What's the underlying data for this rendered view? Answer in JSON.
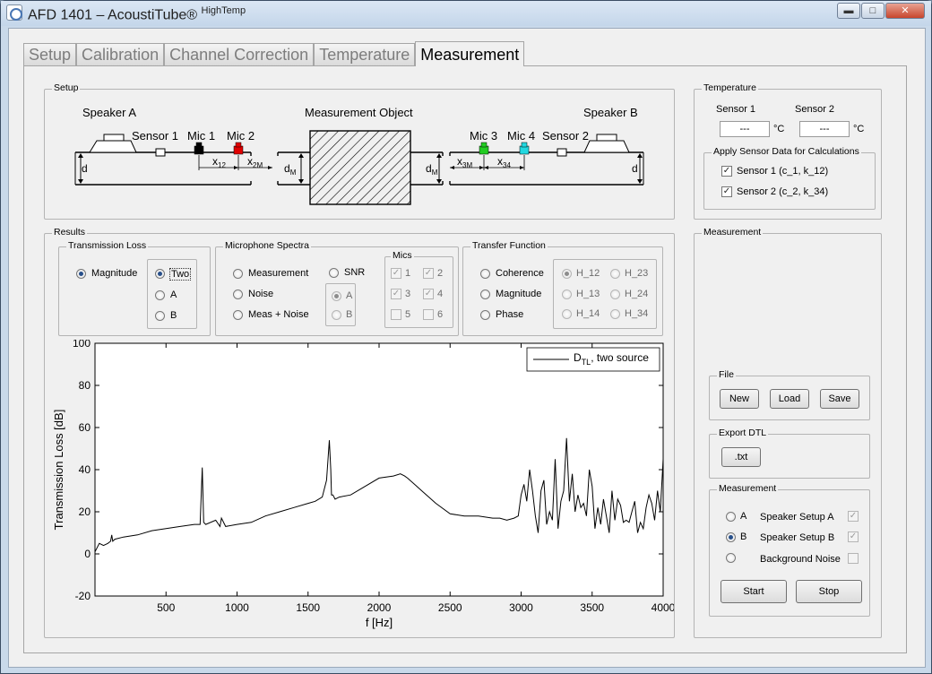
{
  "window": {
    "title": "AFD 1401 – AcoustiTube",
    "title_reg": "®",
    "title_sup": "HighTemp",
    "buttons": {
      "minimize": "▬",
      "maximize": "□",
      "close": "✕"
    }
  },
  "tabs": [
    "Setup",
    "Calibration",
    "Channel Correction",
    "Temperature",
    "Measurement"
  ],
  "active_tab": "Measurement",
  "setup": {
    "label": "Setup",
    "speaker_a": "Speaker A",
    "speaker_b": "Speaker B",
    "sensor1": "Sensor 1",
    "sensor2": "Sensor 2",
    "mic1": "Mic 1",
    "mic2": "Mic 2",
    "mic3": "Mic 3",
    "mic4": "Mic 4",
    "object": "Measurement Object",
    "d": "d",
    "d_right": "d",
    "dm_left": "d",
    "dm_right": "d",
    "dm_sub": "M",
    "x12": "x",
    "x12_sub": "12",
    "x2m": "x",
    "x2m_sub": "2M",
    "x3m": "x",
    "x3m_sub": "3M",
    "x34": "x",
    "x34_sub": "34",
    "colors": {
      "mic1": "#000000",
      "mic2": "#e00000",
      "mic3": "#22cc22",
      "mic4": "#22d8e0"
    }
  },
  "temperature": {
    "label": "Temperature",
    "sensor1_label": "Sensor 1",
    "sensor2_label": "Sensor 2",
    "sensor1_value": "---",
    "sensor2_value": "---",
    "unit": "°C",
    "apply_label": "Apply Sensor Data for Calculations",
    "apply_items": [
      {
        "label": "Sensor 1 (c_1, k_12)",
        "checked": true
      },
      {
        "label": "Sensor 2 (c_2, k_34)",
        "checked": true
      }
    ]
  },
  "results": {
    "label": "Results",
    "transmission_loss": {
      "label": "Transmission Loss",
      "magnitude": "Magnitude",
      "options": [
        "Two",
        "A",
        "B"
      ],
      "selected": "Two"
    },
    "mic_spectra": {
      "label": "Microphone Spectra",
      "options": [
        "Measurement",
        "Noise",
        "Meas + Noise"
      ],
      "snr": "SNR",
      "snr_options": [
        "A",
        "B"
      ],
      "mics_label": "Mics",
      "mics": [
        "1",
        "2",
        "3",
        "4",
        "5",
        "6"
      ],
      "mics_checked": [
        true,
        true,
        true,
        true,
        false,
        false
      ]
    },
    "transfer_function": {
      "label": "Transfer Function",
      "options": [
        "Coherence",
        "Magnitude",
        "Phase"
      ],
      "h_options": [
        "H_12",
        "H_23",
        "H_13",
        "H_24",
        "H_14",
        "H_34"
      ]
    }
  },
  "chart_data": {
    "type": "line",
    "xlabel": "f [Hz]",
    "ylabel": "Transmission Loss [dB]",
    "xlim": [
      0,
      4000
    ],
    "ylim": [
      -20,
      100
    ],
    "xticks": [
      "500",
      "1000",
      "1500",
      "2000",
      "2500",
      "3000",
      "3500",
      "4000"
    ],
    "yticks": [
      "-20",
      "0",
      "20",
      "40",
      "60",
      "80",
      "100"
    ],
    "legend": {
      "prefix": "D",
      "sub": "TL",
      "suffix": ", two source"
    },
    "legend_position": "top-right",
    "grid": false,
    "series": [
      {
        "name": "D_TL, two source",
        "x": [
          0,
          30,
          60,
          90,
          110,
          118,
          125,
          140,
          200,
          300,
          400,
          500,
          600,
          700,
          740,
          755,
          765,
          780,
          850,
          880,
          890,
          920,
          1000,
          1100,
          1200,
          1300,
          1400,
          1500,
          1550,
          1600,
          1630,
          1650,
          1660,
          1665,
          1675,
          1690,
          1720,
          1800,
          1900,
          2000,
          2100,
          2150,
          2180,
          2200,
          2250,
          2300,
          2400,
          2500,
          2600,
          2700,
          2800,
          2850,
          2900,
          2950,
          2980,
          3000,
          3020,
          3040,
          3060,
          3080,
          3100,
          3120,
          3140,
          3160,
          3180,
          3200,
          3220,
          3240,
          3260,
          3280,
          3300,
          3320,
          3340,
          3360,
          3380,
          3400,
          3420,
          3440,
          3460,
          3480,
          3500,
          3520,
          3540,
          3560,
          3580,
          3600,
          3620,
          3640,
          3660,
          3680,
          3700,
          3720,
          3740,
          3760,
          3780,
          3800,
          3820,
          3840,
          3860,
          3880,
          3900,
          3920,
          3940,
          3960,
          3980,
          4000
        ],
        "y": [
          1,
          5,
          4,
          5,
          6,
          9,
          6,
          7,
          8,
          9,
          11,
          12,
          13,
          14,
          14,
          41,
          15,
          14,
          16,
          13,
          17,
          13,
          14,
          15,
          18,
          20,
          22,
          24,
          25,
          27,
          35,
          54,
          40,
          28,
          28,
          26,
          27,
          28,
          32,
          36,
          37,
          38,
          37,
          36,
          33,
          30,
          24,
          19,
          18,
          18,
          17,
          17,
          16,
          17,
          18,
          28,
          33,
          25,
          40,
          30,
          18,
          10,
          30,
          35,
          14,
          20,
          16,
          45,
          12,
          25,
          30,
          55,
          25,
          38,
          20,
          28,
          22,
          24,
          18,
          40,
          32,
          12,
          22,
          14,
          26,
          18,
          10,
          30,
          16,
          26,
          23,
          15,
          16,
          15,
          20,
          25,
          10,
          15,
          12,
          22,
          28,
          24,
          16,
          30,
          20,
          45
        ]
      }
    ]
  },
  "measurement_panel": {
    "label": "Measurement",
    "file": {
      "label": "File",
      "new": "New",
      "load": "Load",
      "save": "Save"
    },
    "export": {
      "label": "Export DTL",
      "txt": ".txt"
    },
    "meas": {
      "label": "Measurement",
      "rows": [
        {
          "radio": "A",
          "setup": "Speaker Setup A",
          "checked": true,
          "selected": false
        },
        {
          "radio": "B",
          "setup": "Speaker Setup B",
          "checked": true,
          "selected": true
        },
        {
          "radio": "",
          "setup": "Background Noise",
          "checked": false,
          "selected": false
        }
      ],
      "start": "Start",
      "stop": "Stop"
    }
  }
}
